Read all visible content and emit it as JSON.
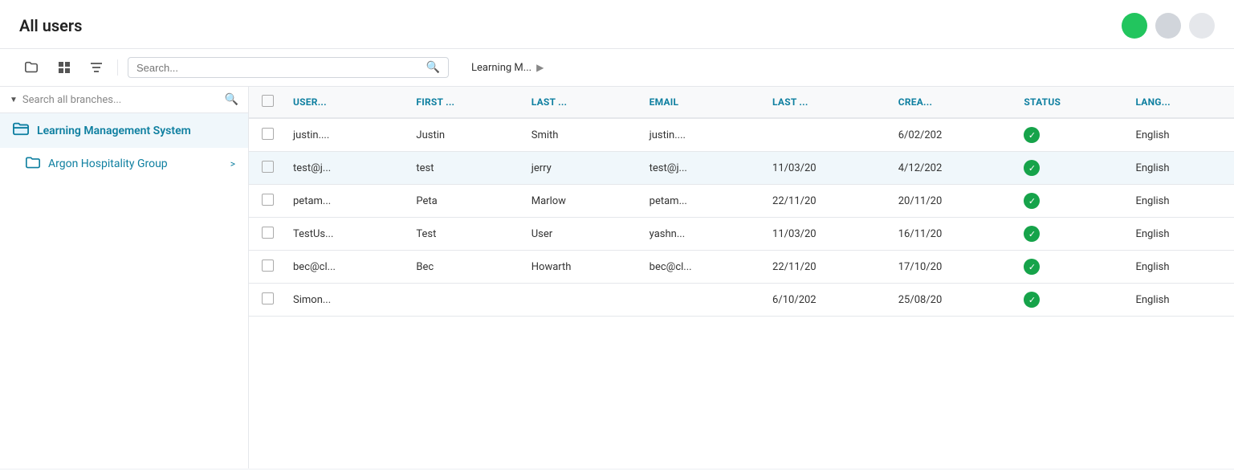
{
  "header": {
    "title": "All users",
    "avatars": [
      {
        "id": "avatar-green",
        "color": "#22c55e"
      },
      {
        "id": "avatar-gray",
        "color": "#d1d5db"
      },
      {
        "id": "avatar-light",
        "color": "#e5e7eb"
      }
    ]
  },
  "toolbar": {
    "search_placeholder": "Search...",
    "breadcrumb_text": "Learning M...",
    "breadcrumb_arrow": "▶",
    "icons": {
      "folder": "🗂",
      "grid": "▦",
      "filter": "≡",
      "search": "🔍"
    }
  },
  "sidebar": {
    "search_placeholder": "Search all branches...",
    "items": [
      {
        "label": "Learning Management System",
        "icon": "folder-open",
        "active": true,
        "has_chevron": false
      },
      {
        "label": "Argon Hospitality Group",
        "icon": "folder",
        "active": false,
        "has_chevron": true
      }
    ]
  },
  "table": {
    "columns": [
      "USER...",
      "FIRST ...",
      "LAST ...",
      "EMAIL",
      "LAST ...",
      "CREA...",
      "STATUS",
      "LANG..."
    ],
    "rows": [
      {
        "username": "justin....",
        "first": "Justin",
        "last": "Smith",
        "email": "justin....",
        "last_login": "",
        "created": "6/02/202",
        "status": "active",
        "lang": "English",
        "highlighted": false
      },
      {
        "username": "test@j...",
        "first": "test",
        "last": "jerry",
        "email": "test@j...",
        "last_login": "11/03/20",
        "created": "4/12/202",
        "status": "active",
        "lang": "English",
        "highlighted": true
      },
      {
        "username": "petam...",
        "first": "Peta",
        "last": "Marlow",
        "email": "petam...",
        "last_login": "22/11/20",
        "created": "20/11/20",
        "status": "active",
        "lang": "English",
        "highlighted": false
      },
      {
        "username": "TestUs...",
        "first": "Test",
        "last": "User",
        "email": "yashn...",
        "last_login": "11/03/20",
        "created": "16/11/20",
        "status": "active",
        "lang": "English",
        "highlighted": false
      },
      {
        "username": "bec@cl...",
        "first": "Bec",
        "last": "Howarth",
        "email": "bec@cl...",
        "last_login": "22/11/20",
        "created": "17/10/20",
        "status": "active",
        "lang": "English",
        "highlighted": false
      },
      {
        "username": "Simon...",
        "first": "",
        "last": "",
        "email": "",
        "last_login": "6/10/202",
        "created": "25/08/20",
        "status": "active",
        "lang": "English",
        "highlighted": false
      }
    ]
  }
}
